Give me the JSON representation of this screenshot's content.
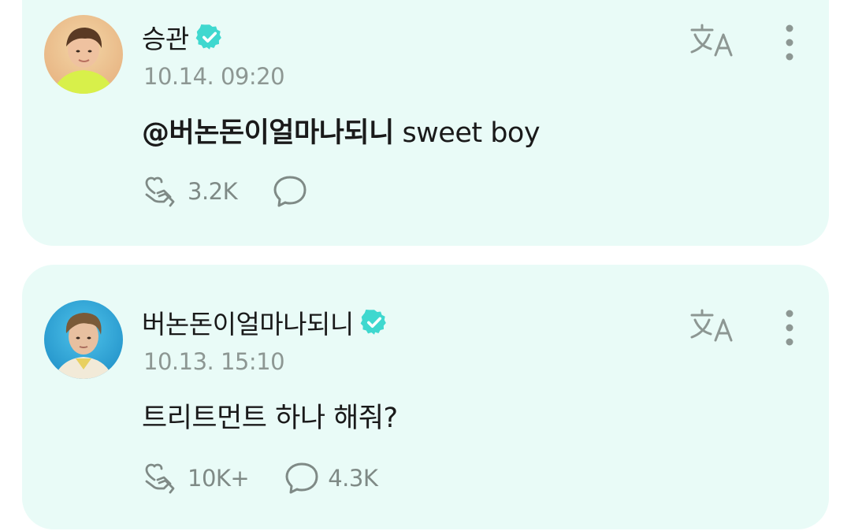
{
  "colors": {
    "card_background": "#e9fbf7",
    "verified_badge": "#3fd8cf",
    "icon_gray": "#8d9793"
  },
  "posts": [
    {
      "author": "승관",
      "verified": true,
      "timestamp": "10.14. 09:20",
      "mention": "@버논돈이얼마나되니",
      "text": " sweet boy",
      "like_icon": "hand-heart-like-icon",
      "like_count": "3.2K",
      "comment_icon": "speech-bubble-icon",
      "comment_count": "",
      "translate_icon": "translate-icon",
      "more_icon": "more-vertical-icon"
    },
    {
      "author": "버논돈이얼마나되니",
      "verified": true,
      "timestamp": "10.13. 15:10",
      "mention": "",
      "text": "트리트먼트 하나 해줘?",
      "like_icon": "hand-heart-like-icon",
      "like_count": "10K+",
      "comment_icon": "speech-bubble-icon",
      "comment_count": "4.3K",
      "translate_icon": "translate-icon",
      "more_icon": "more-vertical-icon"
    }
  ]
}
